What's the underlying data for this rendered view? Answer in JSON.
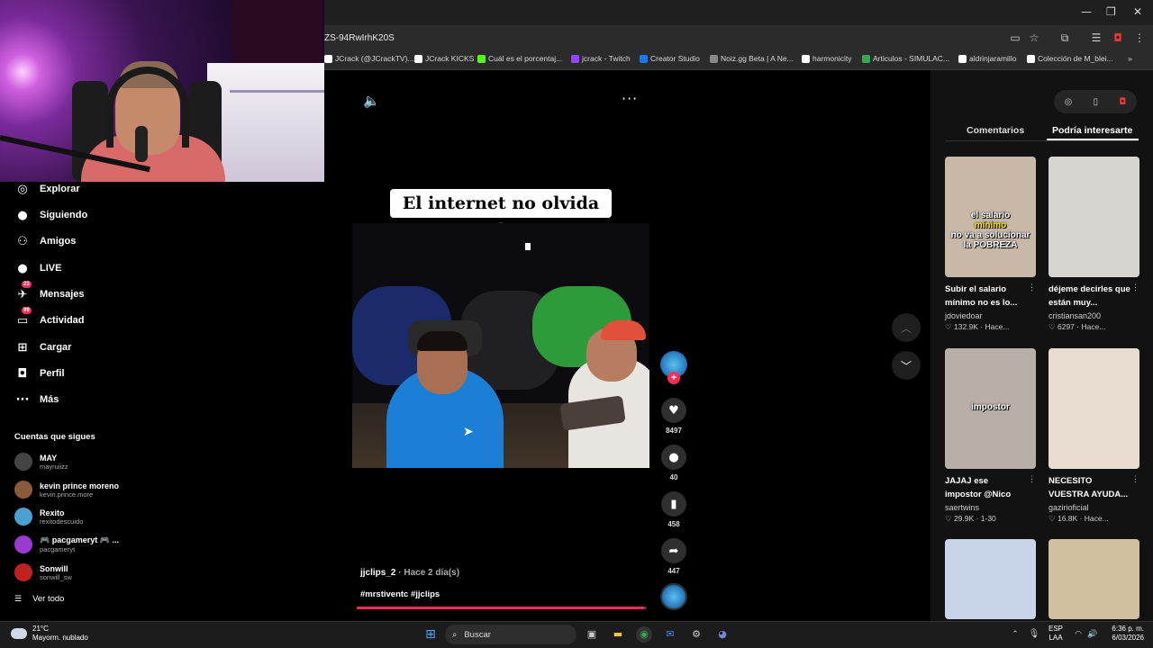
{
  "browser": {
    "url": "ZS-94RwIrhK20S",
    "window_controls": {
      "minimize": "—",
      "restore": "❐",
      "close": "✕"
    },
    "bookmarks": [
      {
        "label": "JCrack (@JCrackTV)...",
        "color": "#ffffff"
      },
      {
        "label": "JCrack KICKS",
        "color": "#ffffff"
      },
      {
        "label": "Cuál es el porcentaj...",
        "color": "#53fc18"
      },
      {
        "label": "jcrack - Twitch",
        "color": "#9146ff"
      },
      {
        "label": "Creator Studio",
        "color": "#1877f2"
      },
      {
        "label": "Noiz.gg Beta | A Ne...",
        "color": "#888888"
      },
      {
        "label": "harmonicity",
        "color": "#ffffff"
      },
      {
        "label": "Articulos - SIMULAC...",
        "color": "#34a853"
      },
      {
        "label": "aldrinjaramillo",
        "color": "#ffffff"
      },
      {
        "label": "Colección de M_blei...",
        "color": "#ffffff"
      }
    ],
    "more_bookmarks": "»"
  },
  "sidebar": {
    "nav": [
      {
        "label": "Explorar",
        "icon": "compass-icon",
        "glyph": "◎"
      },
      {
        "label": "Siguiendo",
        "icon": "following-icon",
        "glyph": "●"
      },
      {
        "label": "Amigos",
        "icon": "friends-icon",
        "glyph": "⚇"
      },
      {
        "label": "LIVE",
        "icon": "live-icon",
        "glyph": "●"
      },
      {
        "label": "Mensajes",
        "icon": "messages-icon",
        "glyph": "✈",
        "badge": "23"
      },
      {
        "label": "Actividad",
        "icon": "activity-icon",
        "glyph": "▭",
        "badge": "99"
      },
      {
        "label": "Cargar",
        "icon": "upload-icon",
        "glyph": "⊞"
      },
      {
        "label": "Perfil",
        "icon": "profile-icon",
        "glyph": "◘"
      },
      {
        "label": "Más",
        "icon": "more-icon",
        "glyph": "···"
      }
    ],
    "following_title": "Cuentas que sigues",
    "accounts": [
      {
        "name": "MAY",
        "handle": "mayruiizz",
        "color": "#444444"
      },
      {
        "name": "kevin prince moreno",
        "handle": "kevin.prince.more",
        "color": "#8a5a3a"
      },
      {
        "name": "Rexito",
        "handle": "rexitodescuido",
        "color": "#4aa0d0"
      },
      {
        "name": "🎮 pacgameryt 🎮 ...",
        "handle": "pacgameryt",
        "color": "#9a3ad0"
      },
      {
        "name": "Sonwill",
        "handle": "sonwill_sw",
        "color": "#c02020"
      }
    ],
    "see_all": "Ver todo"
  },
  "video": {
    "caption_overlay": "El internet no olvida 🤫",
    "author": "jjclips_2",
    "posted": " · Hace 2 día(s)",
    "tags": "#mrstiventc #jjclips",
    "progress": 0.99,
    "likes": "8497",
    "comments": "40",
    "saves": "458",
    "shares": "447"
  },
  "panel": {
    "tabs": {
      "comments": "Comentarios",
      "recommended": "Podría interesarte"
    },
    "cards": [
      {
        "title": "Subir el salario mínimo no es lo...",
        "user": "jdoviedoar",
        "likes": "132.9K",
        "time": "Hace...",
        "overlay_a": "el salario",
        "overlay_b": "mínimo",
        "overlay_c": "no va a solucionar la POBREZA",
        "bg": "#c8b8a8"
      },
      {
        "title": "déjeme decirles que están muy...",
        "user": "cristiansan200",
        "likes": "6297",
        "time": "Hace...",
        "bg": "#d8d4d0"
      },
      {
        "title": "JAJAJ ese impostor @Nico",
        "user": "saertwins",
        "likes": "29.9K",
        "time": "1-30",
        "overlay_a": "impostor",
        "bg": "#b8b0a8"
      },
      {
        "title": "NECESITO VUESTRA AYUDA...",
        "user": "gazirioficial",
        "likes": "16.8K",
        "time": "Hace...",
        "bg": "#e8ddd0"
      },
      {
        "title": "",
        "user": "",
        "likes": "",
        "time": "",
        "bg": "#c8d4e8"
      },
      {
        "title": "",
        "user": "",
        "likes": "",
        "time": "",
        "bg": "#d0c0a0"
      }
    ]
  },
  "taskbar": {
    "temp": "21°C",
    "weather": "Mayorm. nublado",
    "search_placeholder": "Buscar",
    "lang_a": "ESP",
    "lang_b": "LAA",
    "time": "6:36 p. m.",
    "date": "6/03/2026"
  }
}
